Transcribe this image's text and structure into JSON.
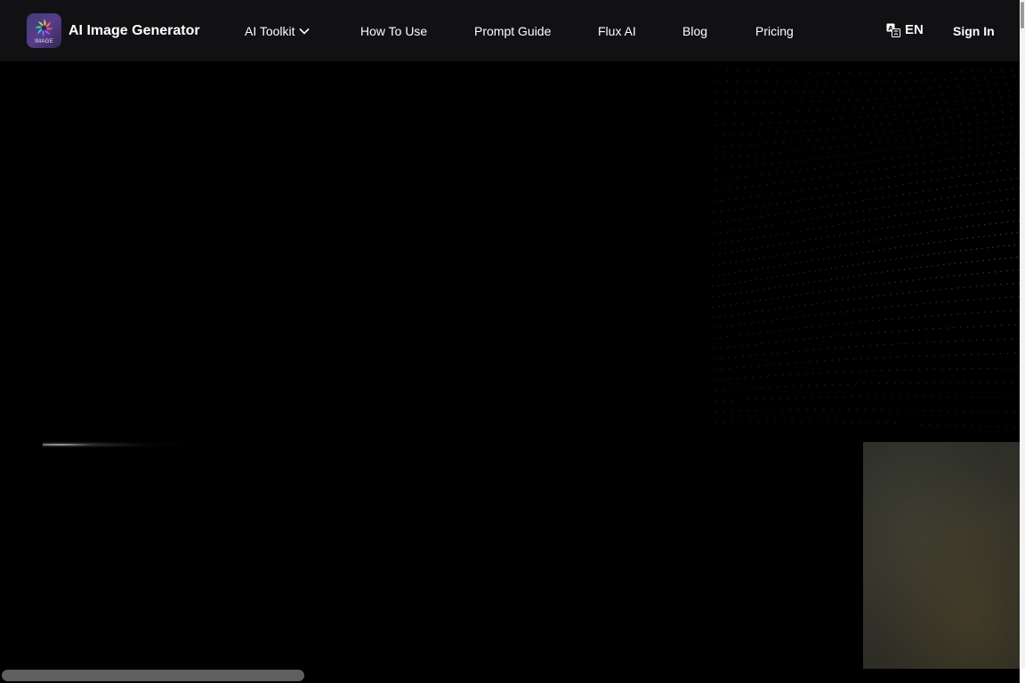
{
  "brand": {
    "logo_text": "IMAGE",
    "name": "AI Image Generator"
  },
  "nav": {
    "items": [
      {
        "label": "AI Toolkit",
        "icon": "chevron-down-icon"
      },
      {
        "label": "How To Use"
      },
      {
        "label": "Prompt Guide"
      },
      {
        "label": "Flux AI"
      },
      {
        "label": "Blog"
      },
      {
        "label": "Pricing"
      }
    ],
    "language": {
      "label": "EN",
      "icon": "translate-icon"
    },
    "sign_in": "Sign In"
  },
  "colors": {
    "header_bg": "#111114",
    "page_bg": "#000000",
    "text": "#ffffff"
  }
}
